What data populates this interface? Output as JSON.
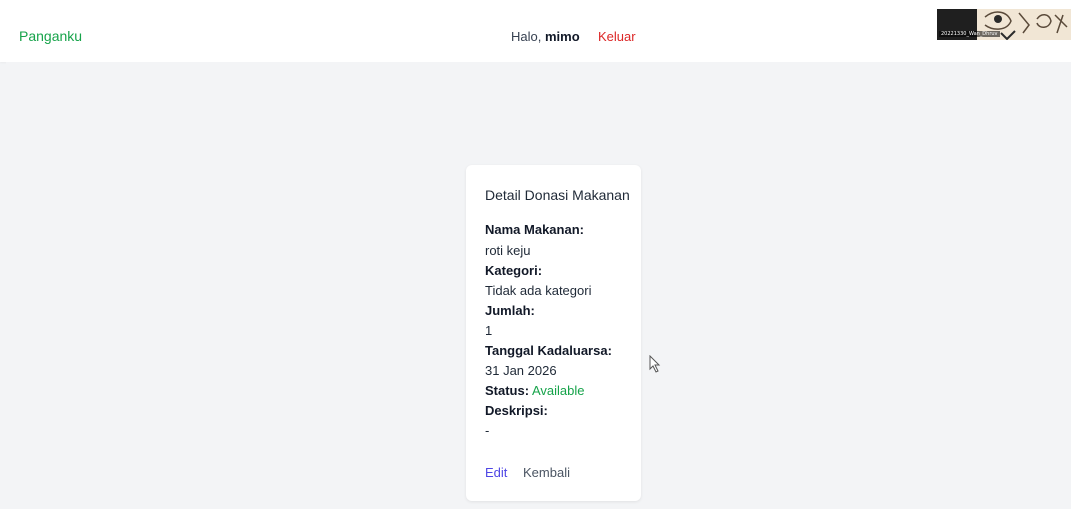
{
  "navbar": {
    "brand": "Panganku",
    "greeting_prefix": "Halo, ",
    "username": "mimo",
    "logout_label": "Keluar"
  },
  "webcam": {
    "caption": "20221330_Wan_Dhruv"
  },
  "card": {
    "title": "Detail Donasi Makanan",
    "fields": {
      "name_label": "Nama Makanan:",
      "name_value": "roti keju",
      "category_label": "Kategori:",
      "category_value": "Tidak ada kategori",
      "quantity_label": "Jumlah:",
      "quantity_value": "1",
      "expiry_label": "Tanggal Kadaluarsa:",
      "expiry_value": "31 Jan 2026",
      "status_label": "Status:",
      "status_value": "Available",
      "description_label": "Deskripsi:",
      "description_value": "-"
    },
    "actions": {
      "edit_label": "Edit",
      "back_label": "Kembali"
    }
  },
  "colors": {
    "brand": "#16a34a",
    "logout": "#dc2626",
    "status": "#16a34a",
    "edit": "#4f46e5",
    "background": "#f3f4f6"
  }
}
